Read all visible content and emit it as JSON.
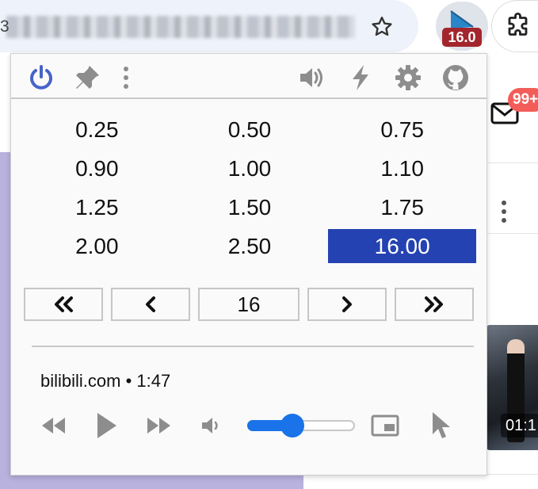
{
  "browser": {
    "url_prefix": "3",
    "extension_badge": "16.0",
    "mail_badge": "99+"
  },
  "page": {
    "video_time": "01:1"
  },
  "popup": {
    "toolbar": {
      "left_icons": [
        "power-icon",
        "pin-icon",
        "kebab-menu-icon"
      ],
      "right_icons": [
        "volume-icon",
        "lightning-icon",
        "gear-icon",
        "github-icon"
      ],
      "accent_color": "#4763c8"
    },
    "speeds": [
      {
        "label": "0.25",
        "active": false
      },
      {
        "label": "0.50",
        "active": false
      },
      {
        "label": "0.75",
        "active": false
      },
      {
        "label": "0.90",
        "active": false
      },
      {
        "label": "1.00",
        "active": false
      },
      {
        "label": "1.10",
        "active": false
      },
      {
        "label": "1.25",
        "active": false
      },
      {
        "label": "1.50",
        "active": false
      },
      {
        "label": "1.75",
        "active": false
      },
      {
        "label": "2.00",
        "active": false
      },
      {
        "label": "2.50",
        "active": false
      },
      {
        "label": "16.00",
        "active": true
      }
    ],
    "active_color": "#2442b2",
    "stepper": {
      "value": "16"
    },
    "media": {
      "title": "bilibili.com • 1:47",
      "volume_fraction": 0.42,
      "slider_color": "#1a73e8"
    }
  }
}
